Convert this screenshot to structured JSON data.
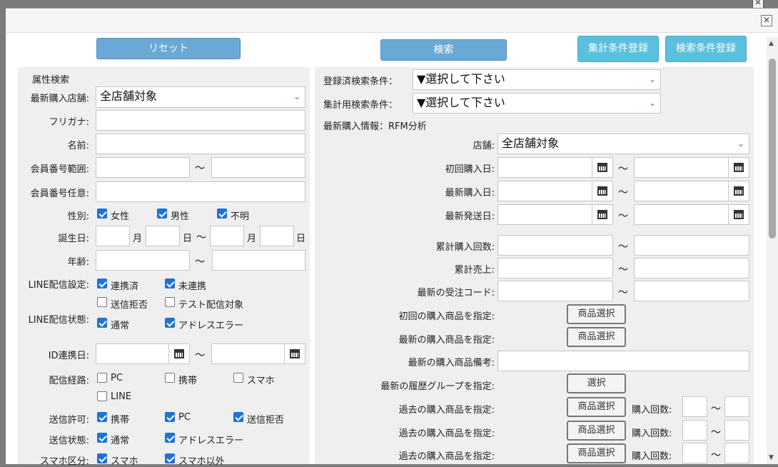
{
  "window": {
    "close": "✕"
  },
  "buttons": {
    "reset": "リセット",
    "search": "検索",
    "register_aggregate": "集計条件登録",
    "register_search": "検索条件登録"
  },
  "left": {
    "section_title": "属性検索",
    "store_label": "最新購入店舗:",
    "store_value": "全店舗対象",
    "furigana_label": "フリガナ:",
    "name_label": "名前:",
    "member_range_label": "会員番号範囲:",
    "member_any_label": "会員番号任意:",
    "gender_label": "性別:",
    "gender": [
      "女性",
      "男性",
      "不明"
    ],
    "birthday_label": "誕生日:",
    "month": "月",
    "day": "日",
    "tilde": "～",
    "age_label": "年齢:",
    "line_setting_label": "LINE配信設定:",
    "line_setting": [
      "連携済",
      "未連携",
      "送信拒否",
      "テスト配信対象"
    ],
    "line_status_label": "LINE配信状態:",
    "line_status": [
      "通常",
      "アドレスエラー"
    ],
    "id_link_label": "ID連携日:",
    "route_label": "配信経路:",
    "route": [
      "PC",
      "携帯",
      "スマホ",
      "LINE"
    ],
    "permit_label": "送信許可:",
    "permit": [
      "携帯",
      "PC",
      "送信拒否"
    ],
    "send_status_label": "送信状態:",
    "send_status": [
      "通常",
      "アドレスエラー"
    ],
    "phone_type_label": "スマホ区分:",
    "phone_type": [
      "スマホ",
      "スマホ以外"
    ]
  },
  "right": {
    "registered_search_label": "登録済検索条件：",
    "aggregate_label": "集計用検索条件：",
    "select_placeholder": "▼選択して下さい",
    "rfm_title": "最新購入情報：RFM分析",
    "store_label": "店舗:",
    "store_value": "全店舗対象",
    "first_purchase_label": "初回購入日:",
    "latest_purchase_label": "最新購入日:",
    "latest_ship_label": "最新発送日:",
    "total_count_label": "累計購入回数:",
    "total_sales_label": "累計売上:",
    "latest_order_label": "最新の受注コード:",
    "first_product_label": "初回の購入商品を指定:",
    "latest_product_label": "最新の購入商品を指定:",
    "latest_note_label": "最新の購入商品備考:",
    "latest_group_label": "最新の履歴グループを指定:",
    "past_product_label": "過去の購入商品を指定:",
    "product_select": "商品選択",
    "select": "選択",
    "purchase_count": "購入回数:",
    "tilde": "～"
  },
  "colors": {
    "accent": "#6aa9d6",
    "cyan": "#5bc0de",
    "check": "#1f72d8"
  }
}
